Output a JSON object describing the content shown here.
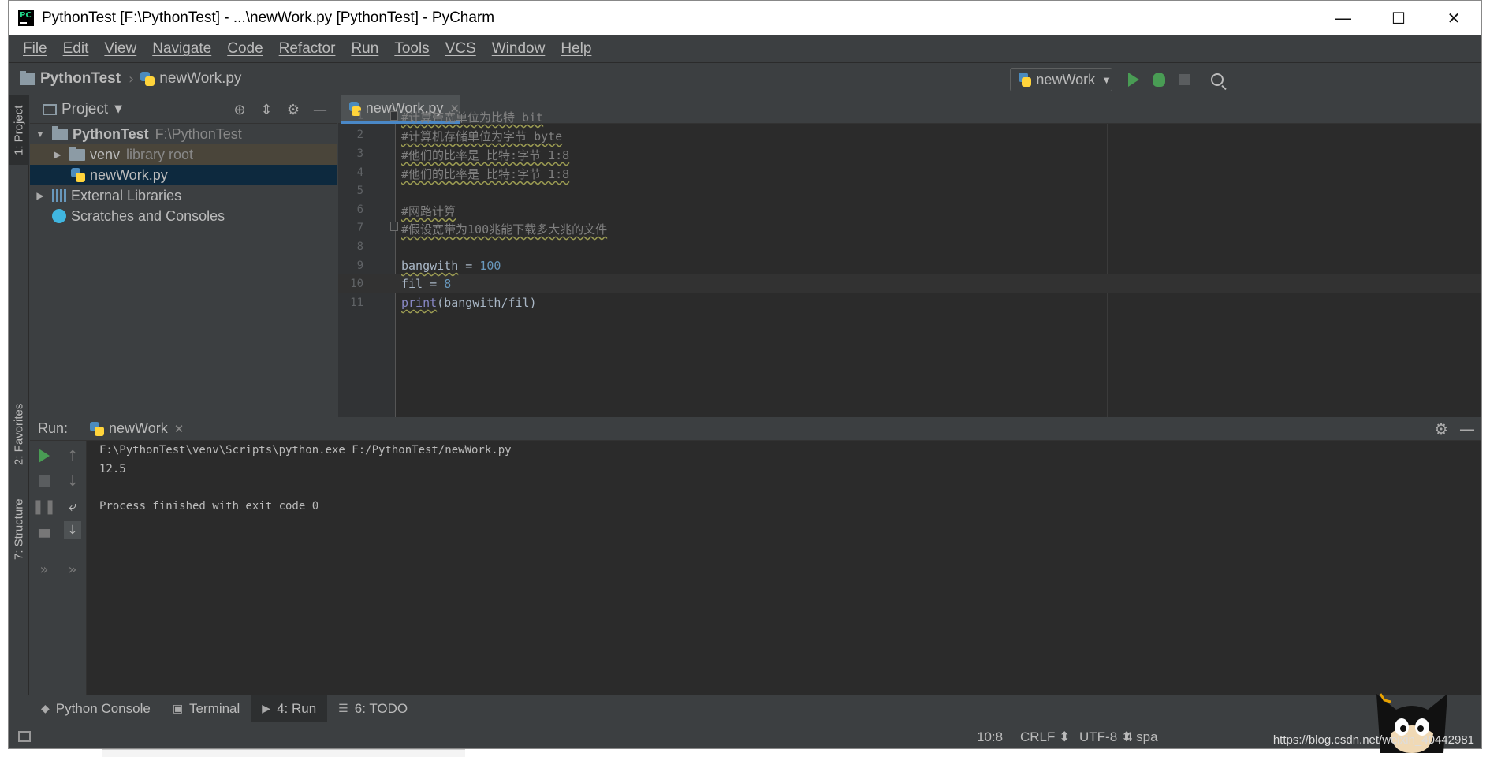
{
  "window": {
    "title": "PythonTest [F:\\PythonTest] - ...\\newWork.py [PythonTest] - PyCharm",
    "app_icon": "PC"
  },
  "menu": [
    "File",
    "Edit",
    "View",
    "Navigate",
    "Code",
    "Refactor",
    "Run",
    "Tools",
    "VCS",
    "Window",
    "Help"
  ],
  "breadcrumb": {
    "project": "PythonTest",
    "file": "newWork.py"
  },
  "run_config": {
    "name": "newWork"
  },
  "left_stripe": {
    "project_tab": "1: Project",
    "favorites_tab": "2: Favorites",
    "structure_tab": "7: Structure"
  },
  "project_panel": {
    "title": "Project",
    "tree": [
      {
        "label": "PythonTest",
        "hint": "F:\\PythonTest"
      },
      {
        "label": "venv",
        "hint": "library root"
      },
      {
        "label": "newWork.py",
        "hint": ""
      },
      {
        "label": "External Libraries",
        "hint": ""
      },
      {
        "label": "Scratches and Consoles",
        "hint": ""
      }
    ]
  },
  "editor": {
    "tab": "newWork.py",
    "lines": [
      {
        "n": "1",
        "text": "#计算带宽单位为比特 bit"
      },
      {
        "n": "2",
        "text": "#计算机存储单位为字节 byte"
      },
      {
        "n": "3",
        "text": "#他们的比率是 比特:字节 1:8"
      },
      {
        "n": "4",
        "text": "#他们的比率是 比特:字节 1:8"
      },
      {
        "n": "5",
        "text": ""
      },
      {
        "n": "6",
        "text": "#网路计算"
      },
      {
        "n": "7",
        "text": "#假设宽带为100兆能下载多大兆的文件"
      },
      {
        "n": "8",
        "text": ""
      },
      {
        "n": "9",
        "var": "bangwith",
        "op": " = ",
        "val": "100"
      },
      {
        "n": "10",
        "var": "fil",
        "op": " = ",
        "val": "8"
      },
      {
        "n": "11",
        "fn": "print",
        "rest": "(bangwith/fil)"
      }
    ]
  },
  "run_panel": {
    "label": "Run:",
    "tab": "newWork",
    "output": [
      "F:\\PythonTest\\venv\\Scripts\\python.exe F:/PythonTest/newWork.py",
      "12.5",
      "",
      "Process finished with exit code 0"
    ]
  },
  "bottom_tabs": [
    {
      "label": "Python Console"
    },
    {
      "label": "Terminal"
    },
    {
      "label": "4: Run"
    },
    {
      "label": "6: TODO"
    }
  ],
  "status": {
    "position": "10:8",
    "line_sep": "CRLF ⬍",
    "encoding": "UTF-8 ⬍",
    "indent": "4 spa",
    "watermark": "https://blog.csdn.net/weixin_40442981"
  },
  "colors": {
    "bg_dark": "#2b2b2b",
    "panel": "#3c3f41",
    "selection": "#0d293e",
    "tab_underline": "#4a88c7",
    "run_green": "#499c54"
  }
}
